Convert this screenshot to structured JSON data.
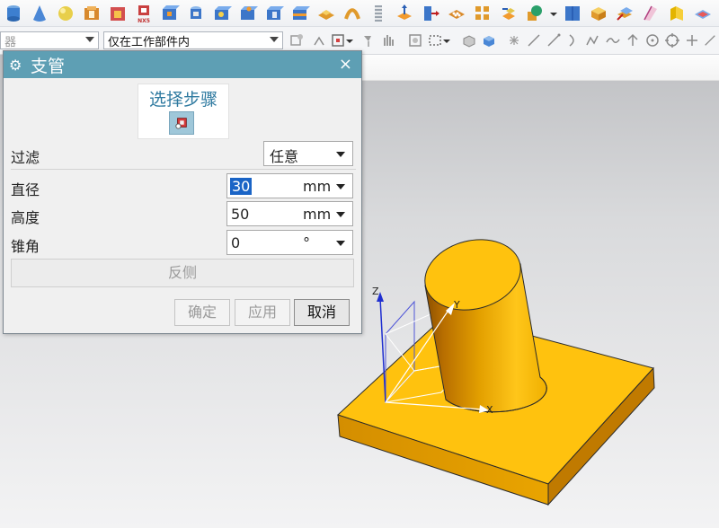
{
  "toolbar_top": {
    "icons": [
      "cylinder-icon",
      "cone-icon",
      "sphere-icon",
      "tube-icon",
      "hollow-box-icon",
      "nx5-icon",
      "boss-icon",
      "pocket-icon",
      "pad-icon",
      "hole-icon",
      "slot-icon",
      "groove-icon",
      "emboss-icon",
      "rib-icon",
      "thread-icon",
      "extrude-icon",
      "move-face-icon",
      "array-feature-icon",
      "pattern-feature-icon",
      "combine-icon",
      "shape-icon",
      "mirror-icon",
      "book-icon",
      "offset-face-icon",
      "draft-icon",
      "bend-icon",
      "sheet-icon",
      "trim-body-icon"
    ],
    "nx5_label": "NX5"
  },
  "toolbar_second": {
    "filter_combo_text": "器",
    "scope_combo_text": "仅在工作部件内"
  },
  "dialog": {
    "title": "支管",
    "close_glyph": "×",
    "step_title": "选择步骤",
    "filter": {
      "label": "过滤",
      "value": "任意"
    },
    "diameter": {
      "label": "直径",
      "value": "30",
      "unit": "mm"
    },
    "height": {
      "label": "高度",
      "value": "50",
      "unit": "mm"
    },
    "taper": {
      "label": "锥角",
      "value": "0",
      "unit": "°"
    },
    "reverse_label": "反侧",
    "ok_label": "确定",
    "apply_label": "应用",
    "cancel_label": "取消"
  },
  "viewport": {
    "axis_labels": {
      "x": "X",
      "y": "Y",
      "z": "Z"
    },
    "colors": {
      "model_top": "#FFC20E",
      "model_side": "#E29A00",
      "axis_z": "#1f2fd0"
    }
  }
}
